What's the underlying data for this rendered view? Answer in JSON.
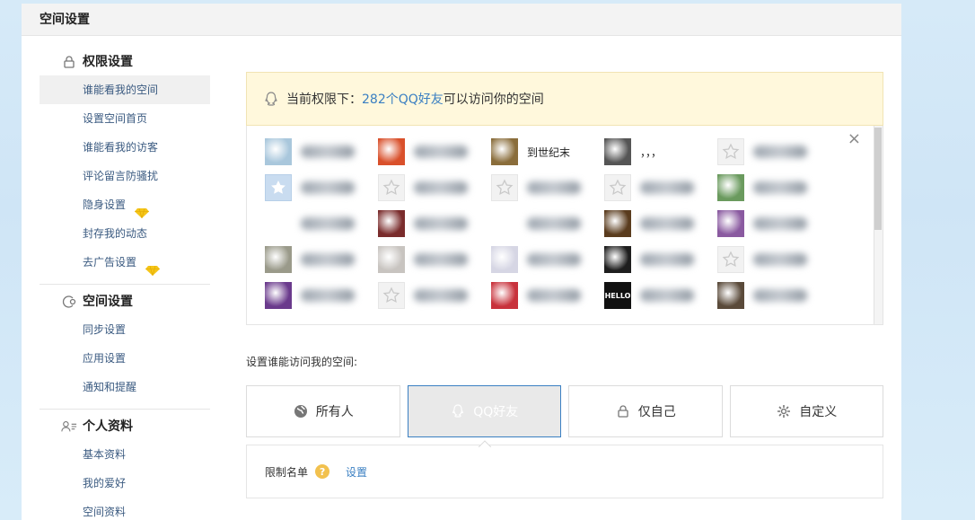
{
  "header": {
    "title": "空间设置"
  },
  "sidebar": {
    "sections": [
      {
        "title": "权限设置",
        "icon": "lock-icon",
        "items": [
          {
            "label": "谁能看我的空间",
            "active": true
          },
          {
            "label": "设置空间首页"
          },
          {
            "label": "谁能看我的访客"
          },
          {
            "label": "评论留言防骚扰"
          },
          {
            "label": "隐身设置",
            "badge": "diamond-icon"
          },
          {
            "label": "封存我的动态"
          },
          {
            "label": "去广告设置",
            "badge": "diamond-icon"
          }
        ]
      },
      {
        "title": "空间设置",
        "icon": "space-settings-icon",
        "items": [
          {
            "label": "同步设置"
          },
          {
            "label": "应用设置"
          },
          {
            "label": "通知和提醒"
          }
        ]
      },
      {
        "title": "个人资料",
        "icon": "profile-icon",
        "items": [
          {
            "label": "基本资料"
          },
          {
            "label": "我的爱好"
          },
          {
            "label": "空间资料"
          }
        ]
      }
    ]
  },
  "notice": {
    "prefix": "当前权限下：",
    "link": "282个QQ好友",
    "suffix": "可以访问你的空间"
  },
  "friends": [
    {
      "name": "",
      "avatar": "photo",
      "color": "#a9c7dc"
    },
    {
      "name": "",
      "avatar": "photo",
      "color": "#d9502b"
    },
    {
      "name": "到世纪末",
      "avatar": "photo",
      "color": "#8a6d3b"
    },
    {
      "name": "，，，",
      "avatar": "photo",
      "color": "#555555"
    },
    {
      "name": "",
      "avatar": "empty"
    },
    {
      "name": "",
      "avatar": "blue"
    },
    {
      "name": "",
      "avatar": "empty"
    },
    {
      "name": "",
      "avatar": "empty"
    },
    {
      "name": "",
      "avatar": "empty"
    },
    {
      "name": "",
      "avatar": "photo",
      "color": "#6a9a5e"
    },
    {
      "name": "",
      "avatar": "none"
    },
    {
      "name": "",
      "avatar": "photo",
      "color": "#7a2c2c"
    },
    {
      "name": "",
      "avatar": "none"
    },
    {
      "name": "",
      "avatar": "photo",
      "color": "#5a3c1e"
    },
    {
      "name": "",
      "avatar": "photo",
      "color": "#8a5aa0"
    },
    {
      "name": "",
      "avatar": "photo",
      "color": "#9a9a8a"
    },
    {
      "name": "",
      "avatar": "photo",
      "color": "#c8c4c0"
    },
    {
      "name": "",
      "avatar": "photo",
      "color": "#d6d6e4"
    },
    {
      "name": "",
      "avatar": "photo",
      "color": "#1e1e1e"
    },
    {
      "name": "",
      "avatar": "empty"
    },
    {
      "name": "",
      "avatar": "photo",
      "color": "#6a3a8c"
    },
    {
      "name": "",
      "avatar": "empty"
    },
    {
      "name": "",
      "avatar": "photo",
      "color": "#c8323c"
    },
    {
      "name": "",
      "avatar": "hello"
    },
    {
      "name": "",
      "avatar": "photo",
      "color": "#5a4a3a"
    }
  ],
  "access_label": "设置谁能访问我的空间:",
  "options": [
    {
      "label": "所有人",
      "icon": "globe-icon"
    },
    {
      "label": "QQ好友",
      "icon": "qq-penguin-icon",
      "selected": true
    },
    {
      "label": "仅自己",
      "icon": "lock-icon"
    },
    {
      "label": "自定义",
      "icon": "gear-icon"
    }
  ],
  "restrict": {
    "label": "限制名单",
    "help": "?",
    "link": "设置"
  },
  "close_glyph": "×"
}
